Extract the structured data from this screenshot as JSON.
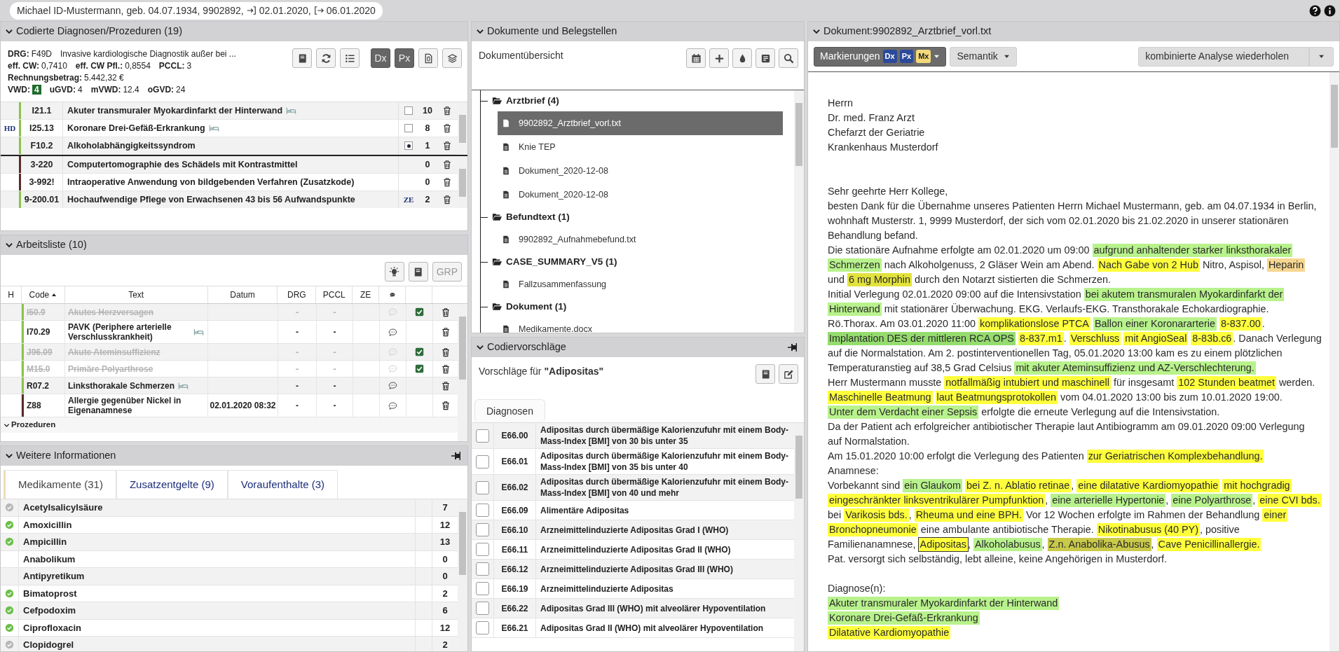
{
  "header": {
    "patient": "Michael ID-Mustermann, geb. 04.07.1934, 9902892,",
    "admission": "02.01.2020,",
    "discharge": "06.01.2020"
  },
  "coded": {
    "title": "Codierte Diagnosen/Prozeduren (19)",
    "expanded": true,
    "summary": [
      [
        {
          "label": "DRG:",
          "value": "F49D",
          "highlighted": false
        },
        {
          "value": "Invasive kardiologische Diagnostik außer bei ...",
          "highlighted": false
        }
      ],
      [
        {
          "label": "eff. CW:",
          "value": "0,7410",
          "highlighted": false
        },
        {
          "label": "eff. CW Pfl.:",
          "value": "0,8554",
          "highlighted": false
        },
        {
          "label": "PCCL:",
          "value": "3",
          "highlighted": false
        }
      ],
      [
        {
          "label": "Rechnungsbetrag:",
          "value": "5.442,32 €",
          "highlighted": false
        }
      ],
      [
        {
          "label": "VWD:",
          "value": "4",
          "highlighted": true
        },
        {
          "label": "uGVD:",
          "value": "4",
          "highlighted": false
        },
        {
          "label": "mVWD:",
          "value": "12.4",
          "highlighted": false
        },
        {
          "label": "oGVD:",
          "value": "24",
          "highlighted": false
        }
      ]
    ],
    "toggles": [
      {
        "label": "Dx",
        "selected": true
      },
      {
        "label": "Px",
        "selected": true
      }
    ],
    "diagnoses": [
      {
        "code": "I21.1",
        "text": "Akuter transmuraler Myokardinfarkt der Hinterwand",
        "inpatient": true,
        "checked": false,
        "count": "10",
        "color": "#8bc34a"
      },
      {
        "marker": "HD",
        "code": "I25.13",
        "text": "Koronare Drei-Gefäß-Erkrankung",
        "inpatient": true,
        "checked": false,
        "count": "8",
        "color": "#8bc34a"
      },
      {
        "code": "F10.2",
        "text": "Alkoholabhängigkeitssyndrom",
        "inpatient": false,
        "checked": true,
        "count": "1",
        "color": "#8bc34a"
      }
    ],
    "procedures": [
      {
        "code": "3-220",
        "text": "Computertomographie des Schädels mit Kontrastmittel",
        "count": "0",
        "color": "#5a2a2a"
      },
      {
        "code": "3-992!",
        "text": "Intraoperative Anwendung von bildgebenden Verfahren (Zusatzkode)",
        "count": "0",
        "color": "#5a2a2a"
      },
      {
        "code": "9-200.01",
        "text": "Hochaufwendige Pflege von Erwachsenen 43 bis 56 Aufwandspunkte",
        "flag": "ZE",
        "count": "2",
        "color": "#8bc34a"
      }
    ]
  },
  "worklist": {
    "title": "Arbeitsliste (10)",
    "expanded": true,
    "grp_button": {
      "label": "GRP",
      "disabled": true
    },
    "columns": [
      {
        "label": "H",
        "sorted": false
      },
      {
        "label": "Code",
        "sorted": true
      },
      {
        "label": "Text",
        "sorted": false
      },
      {
        "label": "Datum",
        "sorted": false
      },
      {
        "label": "DRG",
        "sorted": false
      },
      {
        "label": "PCCL",
        "sorted": false
      },
      {
        "label": "ZE",
        "sorted": false
      }
    ],
    "rows": [
      {
        "code": "I50.9",
        "text": "Akutes Herzversagen",
        "drg": "-",
        "pccl": "-",
        "excluded": true,
        "checked": true,
        "inpatient": false,
        "color": "#8bc34a"
      },
      {
        "code": "I70.29",
        "text": "PAVK (Periphere arterielle Verschlusskrankheit)",
        "drg": "-",
        "pccl": "-",
        "excluded": false,
        "checked": false,
        "inpatient": true,
        "color": "#8bc34a"
      },
      {
        "code": "J96.09",
        "text": "Akute Ateminsuffizienz",
        "drg": "-",
        "pccl": "-",
        "excluded": true,
        "checked": true,
        "inpatient": false,
        "color": "#8bc34a"
      },
      {
        "code": "M15.0",
        "text": "Primäre Polyarthrose",
        "drg": "-",
        "pccl": "-",
        "excluded": true,
        "checked": true,
        "inpatient": false,
        "color": "#8bc34a"
      },
      {
        "code": "R07.2",
        "text": "Linksthorakale Schmerzen",
        "drg": "-",
        "pccl": "-",
        "excluded": false,
        "checked": false,
        "inpatient": true,
        "color": "#8bc34a"
      },
      {
        "code": "Z88",
        "text": "Allergie gegenüber Nickel in Eigenanamnese",
        "date": "02.01.2020 08:32",
        "drg": "-",
        "pccl": "-",
        "excluded": false,
        "checked": false,
        "inpatient": false,
        "color": "#5a2a2a"
      }
    ],
    "group": {
      "label": "Prozeduren",
      "expanded": true
    }
  },
  "more_info": {
    "title": "Weitere Informationen",
    "expanded": true,
    "pinned": true,
    "tabs": [
      {
        "label": "Medikamente (31)",
        "selected": true
      },
      {
        "label": "Zusatzentgelte (9)",
        "selected": false
      },
      {
        "label": "Voraufenthalte (3)",
        "selected": false
      }
    ],
    "medications": [
      {
        "name": "Acetylsalicylsäure",
        "count": "7",
        "color": "#b8b8b8"
      },
      {
        "name": "Amoxicillin",
        "count": "12",
        "color": "#6cbf4a"
      },
      {
        "name": "Ampicillin",
        "count": "13",
        "color": "#6cbf4a"
      },
      {
        "name": "Anabolikum",
        "count": "0"
      },
      {
        "name": "Antipyretikum",
        "count": "0"
      },
      {
        "name": "Bimatoprost",
        "count": "2",
        "color": "#6cbf4a"
      },
      {
        "name": "Cefpodoxim",
        "count": "6",
        "color": "#6cbf4a"
      },
      {
        "name": "Ciprofloxacin",
        "count": "12",
        "color": "#6cbf4a"
      },
      {
        "name": "Clopidogrel",
        "count": "2",
        "color": "#b8b8b8"
      }
    ]
  },
  "documents": {
    "title": "Dokumente und Belegstellen",
    "expanded": true,
    "subtitle": "Dokumentübersicht",
    "tree": [
      {
        "label": "Arztbrief (4)",
        "expanded": true,
        "children": [
          {
            "label": "9902892_Arztbrief_vorl.txt",
            "selected": true
          },
          {
            "label": "Knie TEP",
            "selected": false
          },
          {
            "label": "Dokument_2020-12-08",
            "selected": false
          },
          {
            "label": "Dokument_2020-12-08",
            "selected": false
          }
        ]
      },
      {
        "label": "Befundtext (1)",
        "expanded": true,
        "children": [
          {
            "label": "9902892_Aufnahmebefund.txt",
            "selected": false
          }
        ]
      },
      {
        "label": "CASE_SUMMARY_V5 (1)",
        "expanded": true,
        "children": [
          {
            "label": "Fallzusammenfassung",
            "selected": false
          }
        ]
      },
      {
        "label": "Dokument (1)",
        "expanded": true,
        "children": [
          {
            "label": "Medikamente.docx",
            "selected": false
          }
        ]
      }
    ]
  },
  "suggestions": {
    "title": "Codiervorschläge",
    "expanded": true,
    "pinned": true,
    "subtitle": "Vorschläge für **\"Adipositas\"**",
    "tabs": [
      {
        "label": "Diagnosen",
        "selected": true
      }
    ],
    "rows": [
      {
        "code": "E66.00",
        "text": "Adipositas durch übermäßige Kalorienzufuhr mit einem Body-Mass-Index [BMI] von 30 bis unter 35",
        "checked": false
      },
      {
        "code": "E66.01",
        "text": "Adipositas durch übermäßige Kalorienzufuhr mit einem Body-Mass-Index [BMI] von 35 bis unter 40",
        "checked": false
      },
      {
        "code": "E66.02",
        "text": "Adipositas durch übermäßige Kalorienzufuhr mit einem Body-Mass-Index [BMI] von 40 und mehr",
        "checked": false
      },
      {
        "code": "E66.09",
        "text": "Alimentäre Adipositas",
        "checked": false
      },
      {
        "code": "E66.10",
        "text": "Arzneimittelinduzierte Adipositas Grad I (WHO)",
        "checked": false
      },
      {
        "code": "E66.11",
        "text": "Arzneimittelinduzierte Adipositas Grad II (WHO)",
        "checked": false
      },
      {
        "code": "E66.12",
        "text": "Arzneimittelinduzierte Adipositas Grad III (WHO)",
        "checked": false
      },
      {
        "code": "E66.19",
        "text": "Arzneimittelinduzierte Adipositas",
        "checked": false
      },
      {
        "code": "E66.22",
        "text": "Adipositas Grad III (WHO) mit alveolärer Hypoventilation",
        "checked": false
      },
      {
        "code": "E66.21",
        "text": "Adipositas Grad II (WHO) mit alveolärer Hypoventilation",
        "checked": false
      }
    ]
  },
  "document": {
    "title": "Dokument:9902892_Arztbrief_vorl.txt",
    "expanded": true,
    "markings": {
      "label": "Markierungen",
      "badges": [
        {
          "label": "Dx",
          "color": "#2b4a9b"
        },
        {
          "label": "Px",
          "color": "#2b4a9b"
        },
        {
          "label": "Mx",
          "color": "#f3d97a"
        }
      ]
    },
    "semantics": {
      "label": "Semantik"
    },
    "rerun": {
      "label": "kombinierte Analyse wiederholen"
    },
    "lines": [
      {
        "kind": "text",
        "segments": [
          {
            "kind": "plain",
            "text": "Herrn"
          }
        ]
      },
      {
        "kind": "text",
        "segments": [
          {
            "kind": "plain",
            "text": "Dr. med. Franz Arzt"
          }
        ]
      },
      {
        "kind": "text",
        "segments": [
          {
            "kind": "plain",
            "text": "Chefarzt der Geriatrie"
          }
        ]
      },
      {
        "kind": "text",
        "segments": [
          {
            "kind": "plain",
            "text": "Krankenhaus Musterdorf"
          }
        ]
      },
      {
        "kind": "blank"
      },
      {
        "kind": "blank"
      },
      {
        "kind": "text",
        "segments": [
          {
            "kind": "plain",
            "text": "Sehr geehrte Herr Kollege,"
          }
        ]
      },
      {
        "kind": "text",
        "segments": [
          {
            "kind": "plain",
            "text": "besten Dank für die Übernahme unseres Patienten Herrn Michael Mustermann, geb. am 04.07.1934 in Berlin,"
          }
        ]
      },
      {
        "kind": "text",
        "segments": [
          {
            "kind": "plain",
            "text": "wohnhaft Musterstr. 1, 9999 Musterdorf, der sich vom 02.01.2020 bis 21.02.2020 in unserer stationären"
          }
        ]
      },
      {
        "kind": "text",
        "segments": [
          {
            "kind": "plain",
            "text": "Behandlung befand."
          }
        ]
      },
      {
        "kind": "text",
        "segments": [
          {
            "kind": "plain",
            "text": "Die stationäre Aufnahme erfolgte am 02.01.2020 um 09:00 "
          },
          {
            "kind": "highlight",
            "text": "aufgrund anhaltender starker linksthorakaler",
            "color": "#b8f28c",
            "selected": false
          }
        ]
      },
      {
        "kind": "text",
        "segments": [
          {
            "kind": "highlight",
            "text": "Schmerzen",
            "color": "#b8f28c",
            "selected": false
          },
          {
            "kind": "plain",
            "text": " nach Alkoholgenuss, 2 Gläser Wein am Abend. "
          },
          {
            "kind": "highlight",
            "text": "Nach Gabe von 2 Hub",
            "color": "#ffff3c",
            "selected": false
          },
          {
            "kind": "plain",
            "text": " Nitro, Aspisol, "
          },
          {
            "kind": "highlight",
            "text": "Heparin",
            "color": "#f7d690",
            "selected": false
          }
        ]
      },
      {
        "kind": "text",
        "segments": [
          {
            "kind": "plain",
            "text": "und "
          },
          {
            "kind": "highlight",
            "text": "6 mg Morphin",
            "color": "#e2e23c",
            "selected": false
          },
          {
            "kind": "plain",
            "text": " durch den Notarzt sistierten die Schmerzen."
          }
        ]
      },
      {
        "kind": "text",
        "segments": [
          {
            "kind": "plain",
            "text": "Initial Verlegung 02.01.2020 09:00 auf die Intensivstation "
          },
          {
            "kind": "highlight",
            "text": "bei akutem transmuralen Myokardinfarkt der",
            "color": "#b8f28c",
            "selected": false
          }
        ]
      },
      {
        "kind": "text",
        "segments": [
          {
            "kind": "highlight",
            "text": "Hinterwand",
            "color": "#b8f28c",
            "selected": false
          },
          {
            "kind": "plain",
            "text": " mit stationärer Überwachung. EKG. Verlaufs-EKG. Transthorakale Echokardiographie."
          }
        ]
      },
      {
        "kind": "text",
        "segments": [
          {
            "kind": "plain",
            "text": "Rö.Thorax. Am 03.01.2020 11:00 "
          },
          {
            "kind": "highlight",
            "text": "komplikationslose PTCA",
            "color": "#ffff3c",
            "selected": false
          },
          {
            "kind": "highlight",
            "text": "Ballon einer Koronararterie",
            "color": "#b8f28c",
            "selected": false
          },
          {
            "kind": "highlight",
            "text": "8-837.00",
            "color": "#ffff3c",
            "selected": false
          },
          {
            "kind": "plain",
            "text": "."
          }
        ]
      },
      {
        "kind": "text",
        "segments": [
          {
            "kind": "highlight",
            "text": "Implantation DES der mittleren RCA OPS",
            "color": "#95dc6e",
            "selected": false
          },
          {
            "kind": "highlight",
            "text": "8-837.m1",
            "color": "#ffff3c",
            "selected": false
          },
          {
            "kind": "plain",
            "text": ". "
          },
          {
            "kind": "highlight",
            "text": "Verschluss",
            "color": "#ffff3c",
            "selected": false
          },
          {
            "kind": "highlight",
            "text": "mit AngioSeal",
            "color": "#ffff3c",
            "selected": false
          },
          {
            "kind": "highlight",
            "text": "8-83b.c6",
            "color": "#ffff3c",
            "selected": false
          },
          {
            "kind": "plain",
            "text": ". Danach Verlegung"
          }
        ]
      },
      {
        "kind": "text",
        "segments": [
          {
            "kind": "plain",
            "text": "auf die Normalstation. Am 2. postinterventionellen Tag, 05.01.2020 13:00 kam es zu einem plötzlichen"
          }
        ]
      },
      {
        "kind": "text",
        "segments": [
          {
            "kind": "plain",
            "text": "Temperaturanstieg auf 38,5 Grad Celsius "
          },
          {
            "kind": "highlight",
            "text": "mit akuter Ateminsuffizienz und AZ-Verschlechterung.",
            "color": "#b8f28c",
            "selected": false
          }
        ]
      },
      {
        "kind": "text",
        "segments": [
          {
            "kind": "plain",
            "text": "Herr Mustermann musste "
          },
          {
            "kind": "highlight",
            "text": "notfallmäßig intubiert und maschinell",
            "color": "#ffff3c",
            "selected": false
          },
          {
            "kind": "plain",
            "text": " für insgesamt "
          },
          {
            "kind": "highlight",
            "text": "102 Stunden beatmet",
            "color": "#ffff3c",
            "selected": false
          },
          {
            "kind": "plain",
            "text": " werden."
          }
        ]
      },
      {
        "kind": "text",
        "segments": [
          {
            "kind": "highlight",
            "text": "Maschinelle Beatmung",
            "color": "#ffff3c",
            "selected": false
          },
          {
            "kind": "highlight",
            "text": "laut Beatmungsprotokollen",
            "color": "#ffff3c",
            "selected": false
          },
          {
            "kind": "plain",
            "text": " vom 04.01.2020 13:00 bis zum 10.01.2020 19:00."
          }
        ]
      },
      {
        "kind": "text",
        "segments": [
          {
            "kind": "highlight",
            "text": "Unter dem Verdacht einer Sepsis",
            "color": "#b8f28c",
            "selected": false
          },
          {
            "kind": "plain",
            "text": " erfolgte die erneute Verlegung auf die Intensivstation."
          }
        ]
      },
      {
        "kind": "text",
        "segments": [
          {
            "kind": "plain",
            "text": "Da der Patient ach erfolgreicher antibiotischer Therapie laut Antibiogramm am 09.01.2020 09:00 Verlegung"
          }
        ]
      },
      {
        "kind": "text",
        "segments": [
          {
            "kind": "plain",
            "text": "auf Normalstation."
          }
        ]
      },
      {
        "kind": "text",
        "segments": [
          {
            "kind": "plain",
            "text": "Am 15.01.2020 10:00 erfolgt die Verlegung des Patienten "
          },
          {
            "kind": "highlight",
            "text": "zur Geriatrischen Komplexbehandlung.",
            "color": "#ffff3c",
            "selected": false
          }
        ]
      },
      {
        "kind": "text",
        "segments": [
          {
            "kind": "plain",
            "text": "Anamnese:"
          }
        ]
      },
      {
        "kind": "text",
        "segments": [
          {
            "kind": "plain",
            "text": "Vorbekannt sind "
          },
          {
            "kind": "highlight",
            "text": "ein Glaukom",
            "color": "#b8f28c",
            "selected": false
          },
          {
            "kind": "highlight",
            "text": "bei Z. n. Ablatio retinae",
            "color": "#ffff3c",
            "selected": false
          },
          {
            "kind": "plain",
            "text": ", "
          },
          {
            "kind": "highlight",
            "text": "eine dilatative Kardiomyopathie",
            "color": "#ffff3c",
            "selected": false
          },
          {
            "kind": "highlight",
            "text": "mit hochgradig",
            "color": "#ffff3c",
            "selected": false
          }
        ]
      },
      {
        "kind": "text",
        "segments": [
          {
            "kind": "highlight",
            "text": "eingeschränkter linksventrikulärer Pumpfunktion",
            "color": "#ffff3c",
            "selected": false
          },
          {
            "kind": "plain",
            "text": ", "
          },
          {
            "kind": "highlight",
            "text": "eine arterielle Hypertonie",
            "color": "#b8f28c",
            "selected": false
          },
          {
            "kind": "plain",
            "text": ", "
          },
          {
            "kind": "highlight",
            "text": "eine Polyarthrose",
            "color": "#b8f28c",
            "selected": false
          },
          {
            "kind": "plain",
            "text": ", "
          },
          {
            "kind": "highlight",
            "text": "eine CVI bds.",
            "color": "#ffff3c",
            "selected": false
          }
        ]
      },
      {
        "kind": "text",
        "segments": [
          {
            "kind": "plain",
            "text": "bei "
          },
          {
            "kind": "highlight",
            "text": "Varikosis bds.",
            "color": "#ffff3c",
            "selected": false
          },
          {
            "kind": "plain",
            "text": ", "
          },
          {
            "kind": "highlight",
            "text": "Rheuma und eine BPH.",
            "color": "#ffff3c",
            "selected": false
          },
          {
            "kind": "plain",
            "text": " Vor 12 Wochen erfolgte im Rahmen der Behandlung "
          },
          {
            "kind": "highlight",
            "text": "einer",
            "color": "#ffff3c",
            "selected": false
          }
        ]
      },
      {
        "kind": "text",
        "segments": [
          {
            "kind": "highlight",
            "text": "Bronchopneumonie",
            "color": "#ffff3c",
            "selected": false
          },
          {
            "kind": "plain",
            "text": " eine ambulante antibiotische Therapie. "
          },
          {
            "kind": "highlight",
            "text": "Nikotinabusus (40 PY)",
            "color": "#ffff3c",
            "selected": false
          },
          {
            "kind": "plain",
            "text": ", positive"
          }
        ]
      },
      {
        "kind": "text",
        "segments": [
          {
            "kind": "plain",
            "text": "Familienanamnese, "
          },
          {
            "kind": "highlight",
            "text": "Adipositas",
            "color": "#ffff3c",
            "selected": true
          },
          {
            "kind": "plain",
            "text": ", "
          },
          {
            "kind": "highlight",
            "text": "Alkoholabusus",
            "color": "#b8f28c",
            "selected": false
          },
          {
            "kind": "plain",
            "text": ", "
          },
          {
            "kind": "highlight",
            "text": "Z.n. Anabolika-Abusus",
            "color": "#c9c94a",
            "selected": false
          },
          {
            "kind": "plain",
            "text": ", "
          },
          {
            "kind": "highlight",
            "text": "Cave Penicillinallergie.",
            "color": "#ffff3c",
            "selected": false
          }
        ]
      },
      {
        "kind": "text",
        "segments": [
          {
            "kind": "plain",
            "text": "Pat. versorgt sich selbständig, lebt alleine, keine Angehörigen in Musterdorf."
          }
        ]
      },
      {
        "kind": "blank"
      },
      {
        "kind": "text",
        "segments": [
          {
            "kind": "plain",
            "text": "Diagnose(n):"
          }
        ]
      },
      {
        "kind": "text",
        "segments": [
          {
            "kind": "highlight",
            "text": "Akuter transmuraler Myokardinfarkt der Hinterwand",
            "color": "#b8f28c",
            "selected": false
          }
        ]
      },
      {
        "kind": "text",
        "segments": [
          {
            "kind": "highlight",
            "text": "Koronare Drei-Gefäß-Erkrankung",
            "color": "#b8f28c",
            "selected": false
          }
        ]
      },
      {
        "kind": "text",
        "segments": [
          {
            "kind": "highlight",
            "text": "Dilatative Kardiomyopathie",
            "color": "#ffff3c",
            "selected": false
          }
        ]
      }
    ]
  }
}
